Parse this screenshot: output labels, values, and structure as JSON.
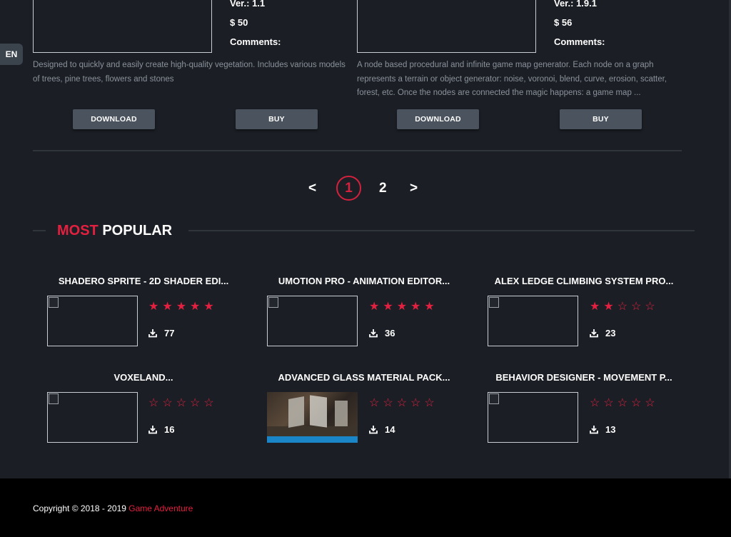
{
  "language": "EN",
  "products": [
    {
      "version": "Ver.: 1.1",
      "price": "$ 50",
      "comments_label": "Comments:",
      "description": "Designed to quickly and easily create high-quality vegetation. Includes various models of trees, pine trees, flowers and stones",
      "download_label": "DOWNLOAD",
      "buy_label": "BUY"
    },
    {
      "version": "Ver.: 1.9.1",
      "price": "$ 56",
      "comments_label": "Comments:",
      "description": "A node based procedural and infinite game map generator. Each node on a graph represents a terrain or object generator: noise, voronoi, blend, curve, erosion, scatter, forest, etc. Once the nodes are connected the magic happens: a game map ...",
      "download_label": "DOWNLOAD",
      "buy_label": "BUY"
    }
  ],
  "pagination": {
    "prev": "<",
    "current": "1",
    "next_page": "2",
    "next": ">"
  },
  "most_popular": {
    "title_accent": "MOST",
    "title_rest": "POPULAR",
    "items": [
      {
        "title": "SHADERO SPRITE - 2D SHADER EDI...",
        "rating": 5,
        "downloads": "77"
      },
      {
        "title": "UMOTION PRO - ANIMATION EDITOR...",
        "rating": 5,
        "downloads": "36"
      },
      {
        "title": "ALEX LEDGE CLIMBING SYSTEM PRO...",
        "rating": 2,
        "downloads": "23"
      },
      {
        "title": "VOXELAND...",
        "rating": 0,
        "downloads": "16"
      },
      {
        "title": "ADVANCED GLASS MATERIAL PACK...",
        "rating": 0,
        "downloads": "14"
      },
      {
        "title": "BEHAVIOR DESIGNER - MOVEMENT P...",
        "rating": 0,
        "downloads": "13"
      }
    ],
    "rating_max": 5
  },
  "footer": {
    "copyright": "Copyright © 2018 - 2019 ",
    "brand": "Game Adventure"
  },
  "colors": {
    "background": "#1b1f25",
    "accent": "#e3203f",
    "button": "#4a535e",
    "footer": "#000000"
  }
}
